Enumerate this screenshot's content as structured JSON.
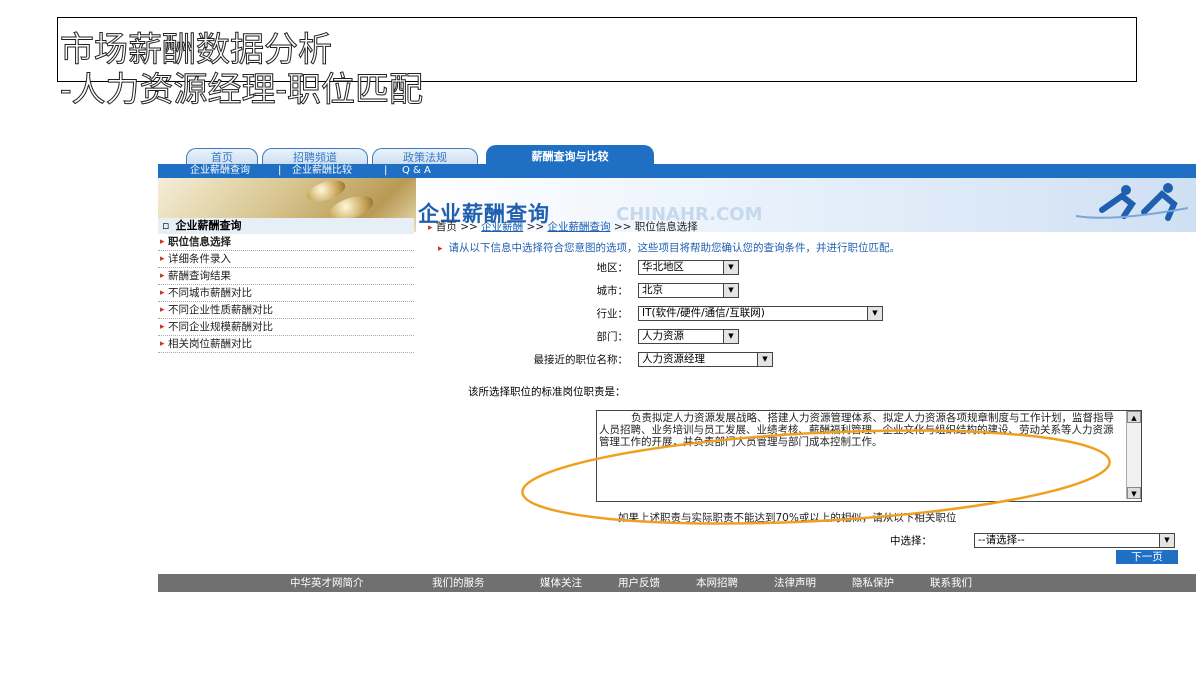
{
  "slide": {
    "title_line1": "市场薪酬数据分析",
    "title_line2": "-人力资源经理-职位匹配"
  },
  "tabs": [
    {
      "label": "首页"
    },
    {
      "label": "招聘频道"
    },
    {
      "label": "政策法规"
    },
    {
      "label": "薪酬查询与比较"
    }
  ],
  "subnav": {
    "items": [
      "企业薪酬查询",
      "企业薪酬比较",
      "Q & A"
    ]
  },
  "banner": {
    "title": "企业薪酬查询",
    "brand": "CHINAHR.COM"
  },
  "sidebar": {
    "heading": "企业薪酬查询",
    "items": [
      {
        "label": "职位信息选择",
        "active": true
      },
      {
        "label": "详细条件录入"
      },
      {
        "label": "薪酬查询结果"
      },
      {
        "label": "不同城市薪酬对比"
      },
      {
        "label": "不同企业性质薪酬对比"
      },
      {
        "label": "不同企业规模薪酬对比"
      },
      {
        "label": "相关岗位薪酬对比"
      }
    ]
  },
  "breadcrumb": {
    "home": "首页",
    "sep": ">>",
    "level1": "企业薪酬",
    "level2": "企业薪酬查询",
    "current": "职位信息选择"
  },
  "instruction": "请从以下信息中选择符合您意图的选项，这些项目将帮助您确认您的查询条件，并进行职位匹配。",
  "form": {
    "region_label": "地区：",
    "region_value": "华北地区",
    "city_label": "城市：",
    "city_value": "北京",
    "industry_label": "行业：",
    "industry_value": "IT(软件/硬件/通信/互联网)",
    "department_label": "部门：",
    "department_value": "人力资源",
    "position_label": "最接近的职位名称：",
    "position_value": "人力资源经理"
  },
  "responsibility": {
    "label": "该所选择职位的标准岗位职责是：",
    "text": "负责拟定人力资源发展战略、搭建人力资源管理体系、拟定人力资源各项规章制度与工作计划，监督指导人员招聘、业务培训与员工发展、业绩考核、薪酬福利管理、企业文化与组织结构的建设、劳动关系等人力资源管理工作的开展，并负责部门人员管理与部门成本控制工作。"
  },
  "note": "如果上述职责与实际职责不能达到70%或以上的相似，请从以下相关职位",
  "choose": {
    "label": "中选择：",
    "value": "--请选择--"
  },
  "next_label": "下一页",
  "footer": {
    "items": [
      "中华英才网简介",
      "我们的服务",
      "媒体关注",
      "用户反馈",
      "本网招聘",
      "法律声明",
      "隐私保护",
      "联系我们"
    ]
  },
  "colors": {
    "nav_blue": "#1f6fc4",
    "link_blue": "#1f5fb0",
    "bullet_red": "#d0302a",
    "annotation_orange": "#f0a020",
    "footer_gray": "#707070"
  }
}
